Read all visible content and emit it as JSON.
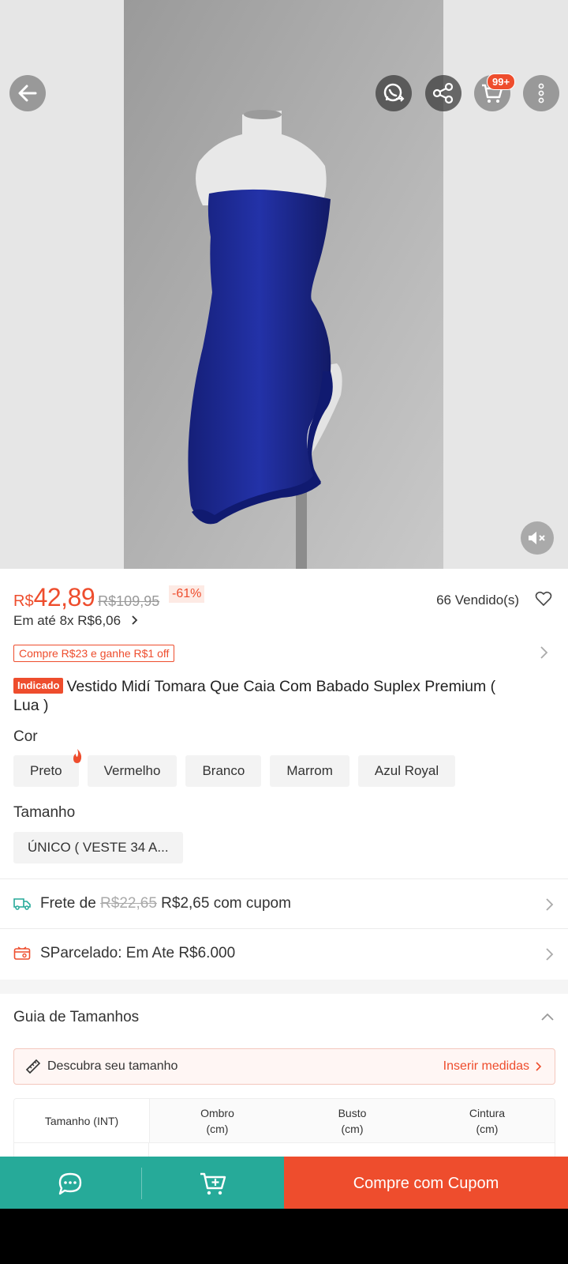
{
  "header": {
    "cart_badge": "99+",
    "icons": [
      "back-arrow-icon",
      "whatsapp-share-icon",
      "share-icon",
      "cart-icon",
      "more-vertical-icon",
      "mute-icon"
    ]
  },
  "product": {
    "currency": "R$",
    "price": "42,89",
    "original_price": "R$109,95",
    "discount": "-61%",
    "sold": "66 Vendido(s)",
    "installments": "Em até 8x R$6,06",
    "coupon": "Compre R$23 e ganhe R$1 off",
    "badge": "Indicado",
    "title": "Vestido Midí Tomara Que Caia Com Babado Suplex Premium ( Lua )"
  },
  "variants": {
    "color_label": "Cor",
    "colors": [
      "Preto",
      "Vermelho",
      "Branco",
      "Marrom",
      "Azul Royal"
    ],
    "size_label": "Tamanho",
    "sizes": [
      "ÚNICO ( VESTE 34 A..."
    ]
  },
  "shipping": {
    "prefix": "Frete de",
    "old": "R$22,65",
    "new": "R$2,65 com cupom"
  },
  "installment_plan": {
    "text": "SParcelado: Em Ate R$6.000"
  },
  "size_guide": {
    "title": "Guia de Tamanhos",
    "measure_label": "Descubra seu tamanho",
    "measure_action": "Inserir medidas",
    "headers": [
      {
        "l1": "Tamanho (INT)",
        "l2": ""
      },
      {
        "l1": "Ombro",
        "l2": "(cm)"
      },
      {
        "l1": "Busto",
        "l2": "(cm)"
      },
      {
        "l1": "Cintura",
        "l2": "(cm)"
      }
    ]
  },
  "bottom": {
    "buy_label": "Compre com Cupom"
  },
  "colors": {
    "accent": "#ee4d2d",
    "teal": "#26aa99",
    "dress": "#1e2a9a"
  }
}
